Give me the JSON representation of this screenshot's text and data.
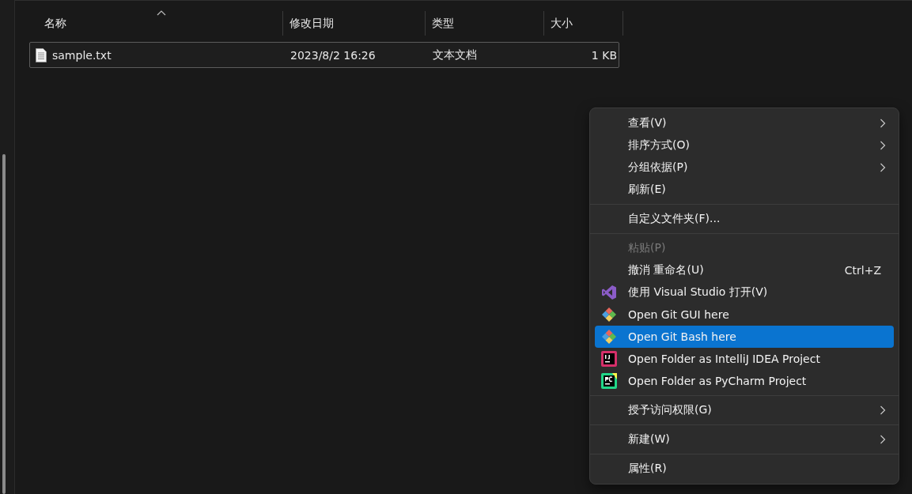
{
  "columns": [
    {
      "label": "名称",
      "sorted": true
    },
    {
      "label": "修改日期",
      "sorted": false
    },
    {
      "label": "类型",
      "sorted": false
    },
    {
      "label": "大小",
      "sorted": false
    }
  ],
  "files": [
    {
      "name": "sample.txt",
      "modified": "2023/8/2 16:26",
      "type": "文本文档",
      "size": "1 KB",
      "focused": true
    }
  ],
  "context_menu": [
    {
      "kind": "plain",
      "label": "查看(V)",
      "submenu": true,
      "disabled": false,
      "selected": false
    },
    {
      "kind": "plain",
      "label": "排序方式(O)",
      "submenu": true,
      "disabled": false,
      "selected": false
    },
    {
      "kind": "plain",
      "label": "分组依据(P)",
      "submenu": true,
      "disabled": false,
      "selected": false
    },
    {
      "kind": "plain",
      "label": "刷新(E)",
      "submenu": false,
      "disabled": false,
      "selected": false
    },
    {
      "kind": "separator"
    },
    {
      "kind": "plain",
      "label": "自定义文件夹(F)...",
      "submenu": false,
      "disabled": false,
      "selected": false
    },
    {
      "kind": "separator"
    },
    {
      "kind": "plain",
      "label": "粘贴(P)",
      "submenu": false,
      "disabled": true,
      "selected": false
    },
    {
      "kind": "plain",
      "label": "撤消 重命名(U)",
      "shortcut": "Ctrl+Z",
      "submenu": false,
      "disabled": false,
      "selected": false
    },
    {
      "kind": "vs",
      "label": "使用 Visual Studio 打开(V)",
      "submenu": false,
      "disabled": false,
      "selected": false
    },
    {
      "kind": "git",
      "label": "Open Git GUI here",
      "submenu": false,
      "disabled": false,
      "selected": false
    },
    {
      "kind": "git",
      "label": "Open Git Bash here",
      "submenu": false,
      "disabled": false,
      "selected": true
    },
    {
      "kind": "intellij",
      "label": "Open Folder as IntelliJ IDEA Project",
      "submenu": false,
      "disabled": false,
      "selected": false
    },
    {
      "kind": "pycharm",
      "label": "Open Folder as PyCharm Project",
      "submenu": false,
      "disabled": false,
      "selected": false
    },
    {
      "kind": "separator"
    },
    {
      "kind": "plain",
      "label": "授予访问权限(G)",
      "submenu": true,
      "disabled": false,
      "selected": false
    },
    {
      "kind": "separator"
    },
    {
      "kind": "plain",
      "label": "新建(W)",
      "submenu": true,
      "disabled": false,
      "selected": false
    },
    {
      "kind": "separator"
    },
    {
      "kind": "plain",
      "label": "属性(R)",
      "submenu": false,
      "disabled": false,
      "selected": false
    }
  ]
}
